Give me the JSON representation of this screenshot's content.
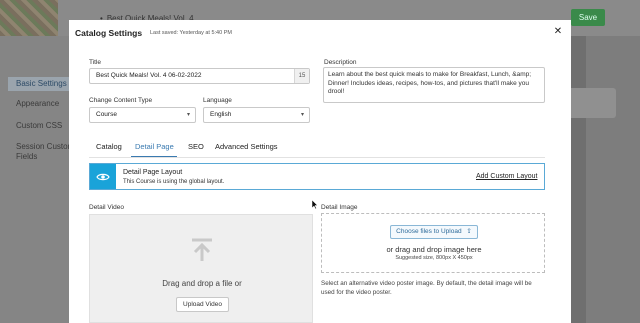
{
  "background": {
    "page_title": "Best Quick Meals! Vol. 4",
    "save_label": "Save",
    "sidebar_items": [
      "Basic Settings",
      "Appearance",
      "Custom CSS",
      "Session Custom Fields"
    ]
  },
  "modal": {
    "title": "Catalog Settings",
    "last_saved": "Last saved: Yesterday at 5:40 PM",
    "close_icon": "close-icon",
    "title_field": {
      "label": "Title",
      "value": "Best Quick Meals! Vol. 4 06-02-2022",
      "counter": "15"
    },
    "description_field": {
      "label": "Description",
      "value": "Learn about the best quick meals to make for Breakfast, Lunch, &amp; Dinner! Includes ideas, recipes, how-tos, and pictures that'll make you drool!"
    },
    "content_type": {
      "label": "Change Content Type",
      "value": "Course"
    },
    "language": {
      "label": "Language",
      "value": "English"
    },
    "tabs": [
      "Catalog",
      "Detail Page",
      "SEO",
      "Advanced Settings"
    ],
    "active_tab": "Detail Page",
    "layout": {
      "title": "Detail Page Layout",
      "subtitle": "This Course is using the global layout.",
      "link": "Add Custom Layout",
      "icon": "eye-icon",
      "accent": "#1aa3d9"
    },
    "video": {
      "label": "Detail Video",
      "drop_text": "Drag and drop a file or",
      "button": "Upload Video",
      "icon": "upload-arrow-icon"
    },
    "image": {
      "label": "Detail Image",
      "button": "Choose files to Upload",
      "drop_text": "or drag and drop image here",
      "size_hint": "Suggested size, 800px X 450px",
      "note": "Select an alternative video poster image. By default, the detail image will be used for the video poster."
    }
  }
}
